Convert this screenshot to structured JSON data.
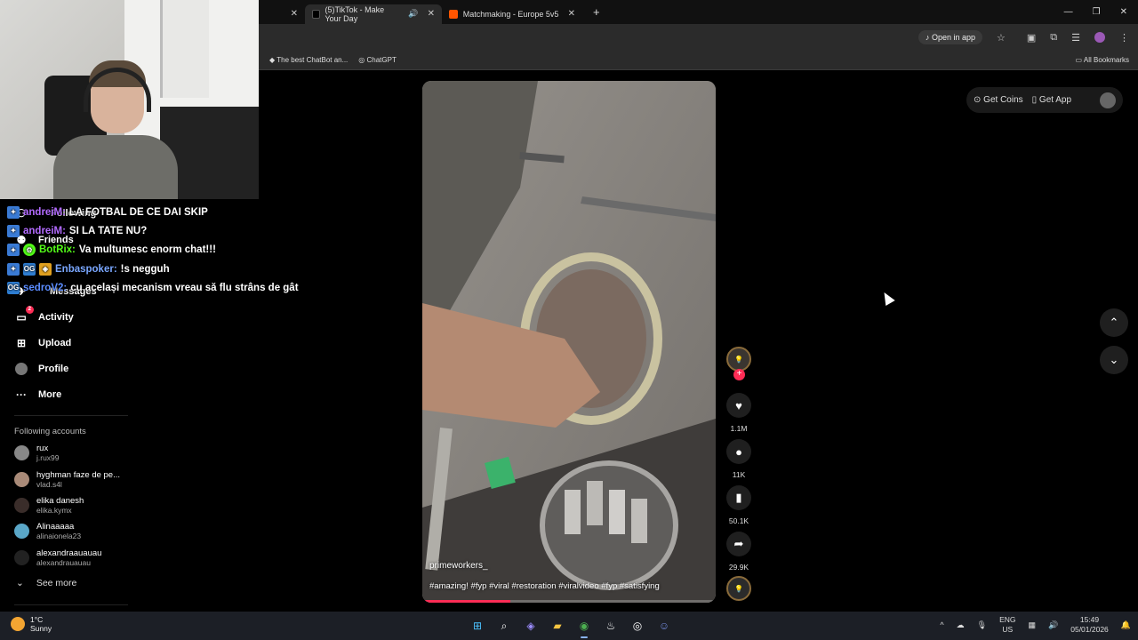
{
  "browser": {
    "tabs": [
      {
        "title": "",
        "active": false
      },
      {
        "title": "(5)TikTok - Make Your Day",
        "active": true
      },
      {
        "title": "Matchmaking - Europe 5v5 Qu",
        "active": false
      }
    ],
    "open_in_app": "Open in app",
    "bookmarks": [
      "The best ChatBot an...",
      "ChatGPT"
    ],
    "all_bookmarks": "All Bookmarks"
  },
  "chat": [
    {
      "name": "andreiM:",
      "name_color": "#b36bff",
      "text": "LA FOTBAL DE CE DAI SKIP"
    },
    {
      "name": "andreiM:",
      "name_color": "#b36bff",
      "text": "SI LA TATE NU?"
    },
    {
      "name": "BotRix:",
      "name_color": "#53fc18",
      "text": "Va multumesc enorm chat!!!"
    },
    {
      "name": "Enbaspoker:",
      "name_color": "#7aa7ff",
      "text": "!s negguh"
    },
    {
      "name": "sedroV2:",
      "name_color": "#5b8cff",
      "text": "cu același mecanism vreau să flu strâns de gât"
    }
  ],
  "sidebar": {
    "items": [
      {
        "label": "Following",
        "icon": "following-icon"
      },
      {
        "label": "Friends",
        "icon": "friends-icon"
      },
      {
        "label": "Messages",
        "icon": "messages-icon"
      },
      {
        "label": "Activity",
        "icon": "activity-icon",
        "badge": "2"
      },
      {
        "label": "Upload",
        "icon": "upload-icon"
      },
      {
        "label": "Profile",
        "icon": "profile-icon"
      },
      {
        "label": "More",
        "icon": "more-icon"
      }
    ],
    "following_title": "Following accounts",
    "accounts": [
      {
        "name": "rux",
        "handle": "j.rux99"
      },
      {
        "name": "hyghman faze de pe...",
        "handle": "vlad.s4l"
      },
      {
        "name": "elika danesh",
        "handle": "elika.kymx"
      },
      {
        "name": "Alinaaaaa",
        "handle": "alinaionela23"
      },
      {
        "name": "alexandraauauau",
        "handle": "alexandrauauau"
      }
    ],
    "see_more": "See more"
  },
  "video": {
    "author": "primeworkers_",
    "caption": "#amazing! #fyp #viral #restoration #viralvideo #fyp #satisfying",
    "progress": 0.3
  },
  "actions": {
    "likes": "1.1M",
    "comments": "11K",
    "saves": "50.1K",
    "shares": "29.9K"
  },
  "topright": {
    "get_coins": "Get Coins",
    "get_app": "Get App"
  },
  "taskbar": {
    "temp": "1°C",
    "weather": "Sunny",
    "lang_top": "ENG",
    "lang_bottom": "US",
    "time": "15:49",
    "date": "05/01/2026"
  }
}
